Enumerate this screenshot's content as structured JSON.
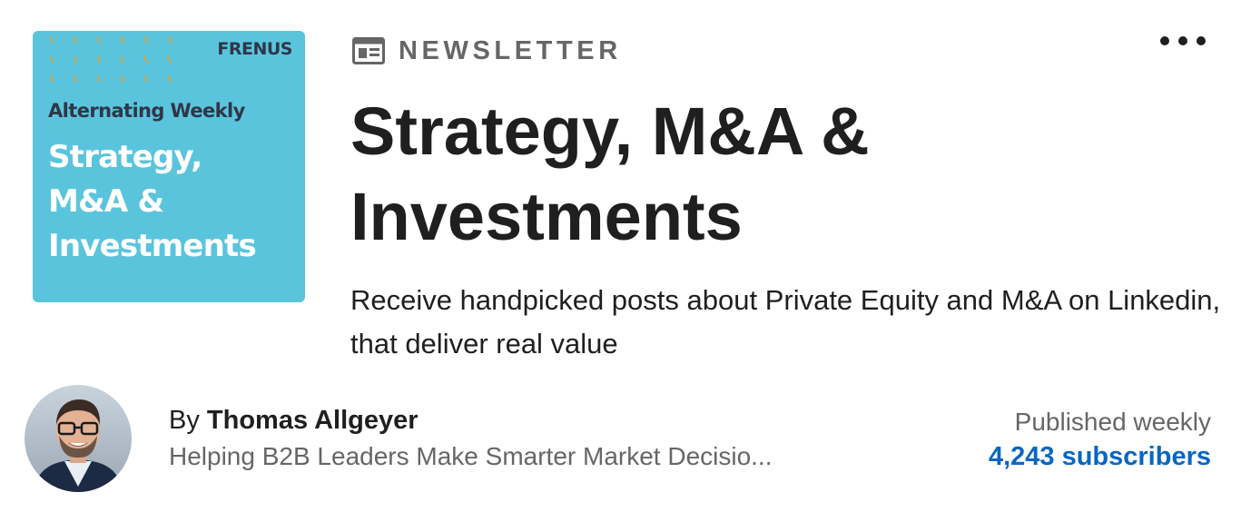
{
  "cover": {
    "brand": "FRENUS",
    "kicker": "Alternating Weekly",
    "title_lines": [
      "Strategy,",
      "M&A &",
      "Investments"
    ],
    "background_color": "#5bc4dd"
  },
  "newsletter": {
    "icon": "newsletter-icon",
    "label": "NEWSLETTER",
    "title": "Strategy, M&A & Investments",
    "description": "Receive handpicked posts about Private Equity and M&A on Linkedin, that deliver real value",
    "more_icon": "more-horizontal-icon"
  },
  "author": {
    "by_label": "By",
    "name": "Thomas Allgeyer",
    "headline": "Helping B2B Leaders Make Smarter Market Decisio..."
  },
  "meta": {
    "frequency": "Published weekly",
    "subscribers": "4,243 subscribers"
  },
  "colors": {
    "accent": "#0a66c2",
    "text": "#1f1f1f",
    "muted": "#666666"
  }
}
